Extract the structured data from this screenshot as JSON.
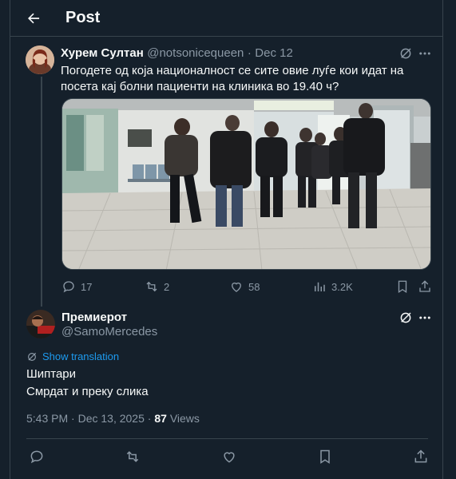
{
  "header": {
    "title": "Post"
  },
  "tweet": {
    "author_name": "Хурем Султан",
    "author_handle": "@notsonicequeen",
    "date": "Dec 12",
    "text": "Погодете од која националност се сите овие луѓе кои идат на посета кај болни пациенти на клиника во 19.40 ч?",
    "stats": {
      "replies": "17",
      "reposts": "2",
      "likes": "58",
      "views": "3.2K"
    }
  },
  "reply": {
    "author_name": "Премиерот",
    "author_handle": "@SamoMercedes",
    "translate_label": "Show translation",
    "lines": [
      "Шиптари",
      "Смрдат и преку слика"
    ],
    "time": "5:43 PM",
    "date": "Dec 13, 2025",
    "views_count": "87",
    "views_label": "Views"
  },
  "colors": {
    "background": "#15202b",
    "accent": "#1d9bf0",
    "muted": "#8b98a5",
    "divider": "#38444d"
  }
}
